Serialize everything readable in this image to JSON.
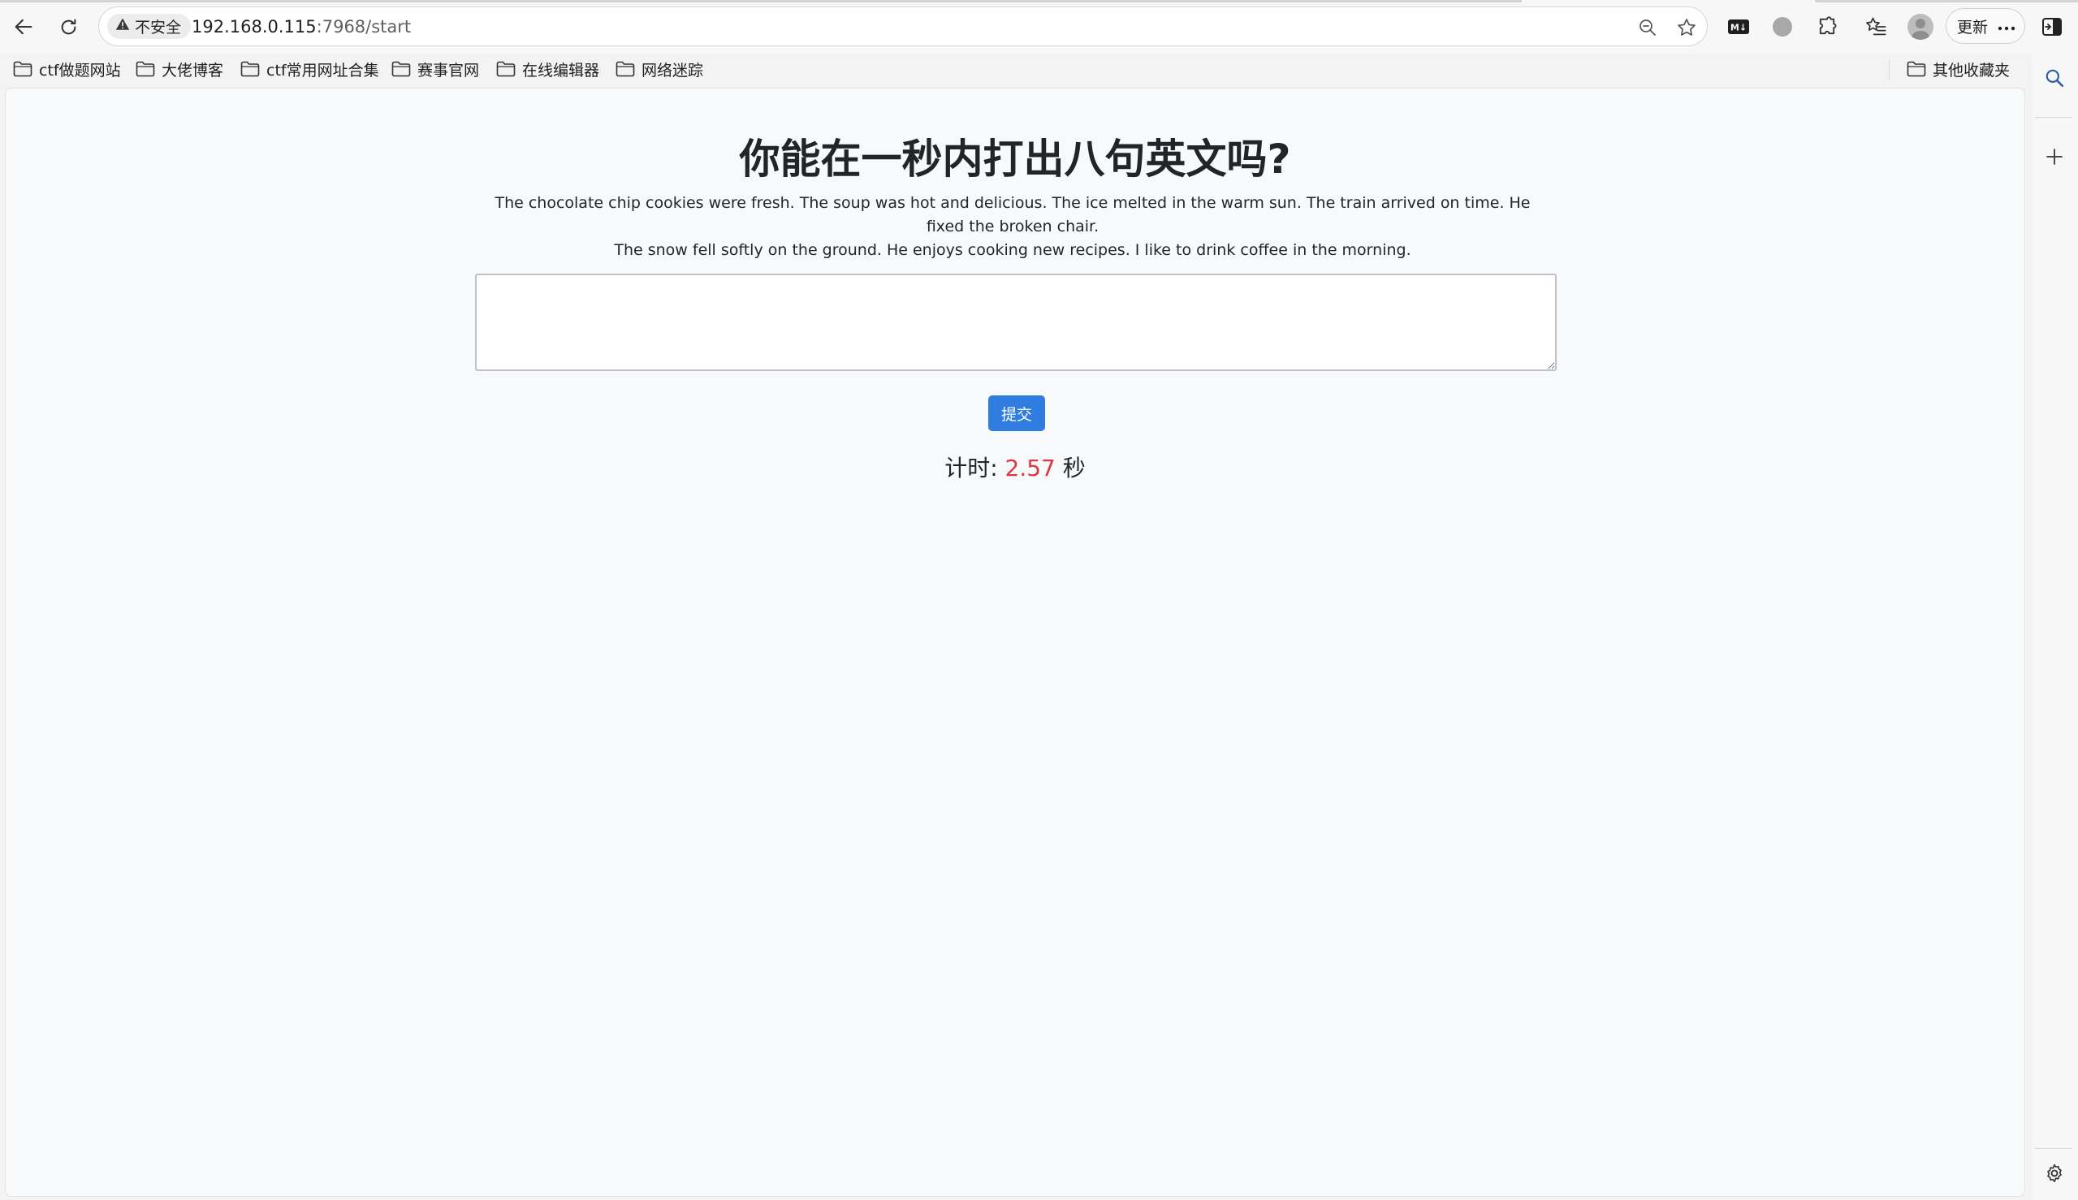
{
  "browser": {
    "insecure_label": "不安全",
    "url_host": "192.168.0.115",
    "url_rest": ":7968/start",
    "update_label": "更新",
    "extension_label": "M↓"
  },
  "bookmarks": {
    "items": [
      {
        "label": "ctf做题网站"
      },
      {
        "label": "大佬博客"
      },
      {
        "label": "ctf常用网址合集"
      },
      {
        "label": "赛事官网"
      },
      {
        "label": "在线编辑器"
      },
      {
        "label": "网络迷踪"
      }
    ],
    "other_label": "其他收藏夹"
  },
  "page": {
    "title": "你能在一秒内打出八句英文吗?",
    "sentences_line1": "The chocolate chip cookies were fresh. The soup was hot and delicious. The ice melted in the warm sun. The train arrived on time. He fixed the broken chair.",
    "sentences_line2": "The snow fell softly on the ground. He enjoys cooking new recipes. I like to drink coffee in the morning.",
    "answer_value": "",
    "submit_label": "提交",
    "timer_label": "计时:",
    "timer_value": "2.57",
    "timer_unit": "秒"
  },
  "colors": {
    "accent_button": "#2f7de1",
    "timer_value": "#dc3545",
    "page_background": "#f8f9fa"
  },
  "icons": [
    "back-arrow-icon",
    "reload-icon",
    "warning-icon",
    "zoom-out-icon",
    "star-icon",
    "markdown-extension-icon",
    "circle-extension-icon",
    "puzzle-icon",
    "favorites-icon",
    "profile-avatar",
    "more-icon",
    "sidebar-toggle-icon",
    "folder-icon",
    "search-icon",
    "plus-icon",
    "gear-icon"
  ]
}
